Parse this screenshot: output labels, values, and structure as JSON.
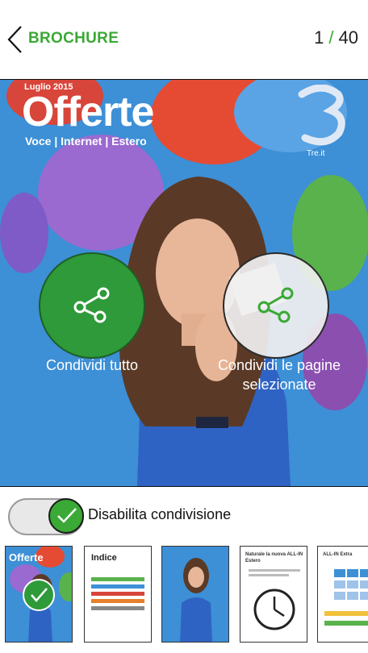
{
  "header": {
    "title": "BROCHURE",
    "page_current": "1",
    "page_separator": "/",
    "page_total": "40"
  },
  "cover": {
    "month": "Luglio 2015",
    "title": "Offerte",
    "subtitle": "Voce | Internet | Estero",
    "brand": "Tre.it"
  },
  "actions": {
    "share_all": "Condividi tutto",
    "share_selected": "Condividi le pagine selezionate"
  },
  "toggle": {
    "label": "Disabilita condivisione",
    "state": "on"
  },
  "thumbnails": [
    {
      "title": "Offerte",
      "selected": true
    },
    {
      "title": "Indice",
      "selected": false
    },
    {
      "title": "",
      "selected": false
    },
    {
      "title": "Naturale la nuova ALL-IN Estero",
      "selected": false
    },
    {
      "title": "ALL-IN Extra",
      "selected": false
    }
  ],
  "colors": {
    "accent": "#3aa935",
    "share_all_bg": "#2e9a3a"
  }
}
